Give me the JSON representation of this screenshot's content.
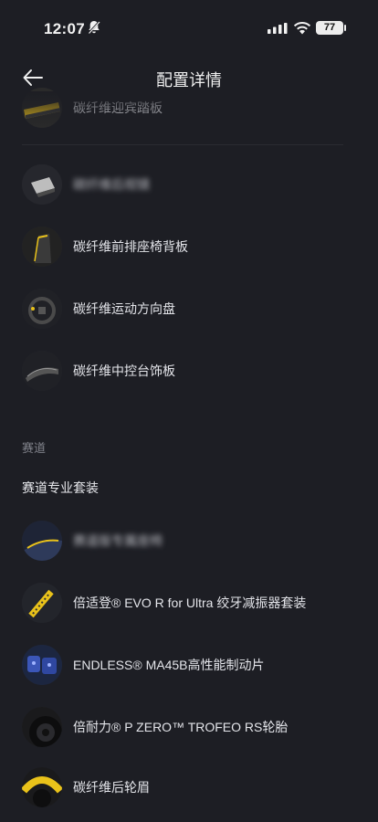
{
  "status_bar": {
    "time": "12:07",
    "battery": "77"
  },
  "header": {
    "title": "配置详情"
  },
  "config_items": [
    {
      "label": "碳纤维迎宾踏板",
      "icon": "door-sill-plate-thumbnail",
      "blurred": false
    },
    {
      "label": "碳纤维后视镜",
      "icon": "mirror-thumbnail",
      "blurred": true
    },
    {
      "label": "碳纤维前排座椅背板",
      "icon": "seat-back-thumbnail",
      "blurred": false
    },
    {
      "label": "碳纤维运动方向盘",
      "icon": "steering-wheel-thumbnail",
      "blurred": false
    },
    {
      "label": "碳纤维中控台饰板",
      "icon": "console-trim-thumbnail",
      "blurred": false
    }
  ],
  "track_section": {
    "caption": "赛道",
    "title": "赛道专业套装",
    "items": [
      {
        "label": "赛道版专属座椅",
        "icon": "track-seat-thumbnail",
        "blurred": true
      },
      {
        "label": "倍适登® EVO R for Ultra 绞牙减振器套装",
        "icon": "shock-absorber-thumbnail",
        "blurred": false
      },
      {
        "label": "ENDLESS® MA45B高性能制动片",
        "icon": "brake-pads-thumbnail",
        "blurred": false
      },
      {
        "label": "倍耐力® P ZERO™ TROFEO RS轮胎",
        "icon": "tire-thumbnail",
        "blurred": false
      },
      {
        "label": "碳纤维后轮眉",
        "icon": "wheel-arch-thumbnail",
        "blurred": false
      }
    ]
  },
  "colors": {
    "background": "#1d1e24",
    "accent": "#e9c21a"
  }
}
